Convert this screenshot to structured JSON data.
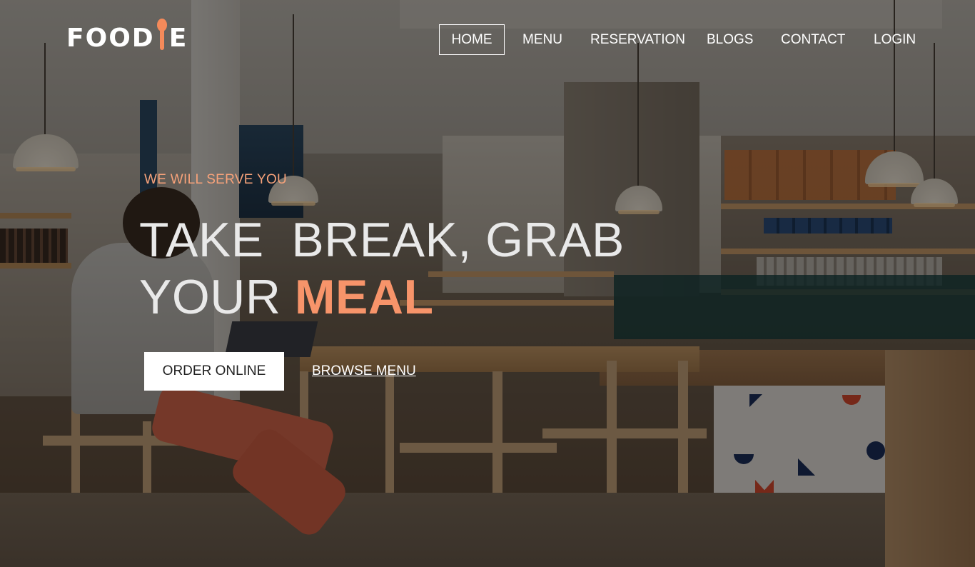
{
  "brand": {
    "name_prefix": "FOOD",
    "name_suffix": "E",
    "accent_color": "#f58a5a"
  },
  "nav": {
    "items": [
      {
        "label": "HOME",
        "active": true
      },
      {
        "label": "MENU",
        "active": false
      },
      {
        "label": "RESERVATION",
        "active": false
      },
      {
        "label": "BLOGS",
        "active": false
      },
      {
        "label": "CONTACT",
        "active": false
      },
      {
        "label": "LOGIN",
        "active": false
      }
    ]
  },
  "hero": {
    "subtitle": "WE WILL SERVE YOU",
    "title_line1": "TAKE  BREAK, GRAB",
    "title_line2_prefix": "YOUR ",
    "title_line2_accent": "MEAL",
    "primary_button": "ORDER ONLINE",
    "secondary_link": "BROWSE MENU",
    "accent_color": "#f7946a"
  }
}
